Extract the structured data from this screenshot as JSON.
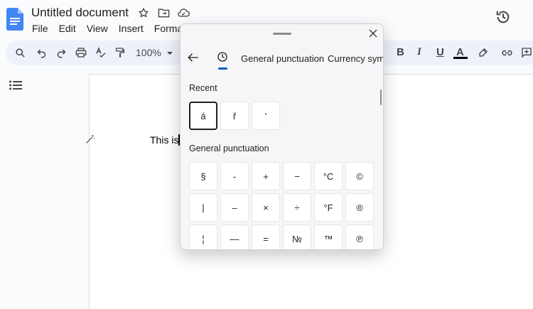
{
  "app": {
    "title": "Untitled document",
    "menu": [
      "File",
      "Edit",
      "View",
      "Insert",
      "Format"
    ]
  },
  "toolbar": {
    "zoom": "100%",
    "bold": "B",
    "italic": "I",
    "underline": "U",
    "text_color": "A"
  },
  "document": {
    "text": "This is"
  },
  "panel": {
    "tabs": [
      "General punctuation",
      "Currency symbo"
    ],
    "recent_label": "Recent",
    "recent": [
      "á",
      "ř",
      "ʹ"
    ],
    "section_label": "General punctuation",
    "symbols": [
      "§",
      "-",
      "+",
      "−",
      "°C",
      "©",
      "|",
      "–",
      "×",
      "÷",
      "°F",
      "®",
      "¦",
      "—",
      "=",
      "№",
      "™",
      "℗"
    ]
  },
  "colors": {
    "accent": "#005fb8",
    "docs_blue": "#4285f4",
    "toolbar_bg": "#edf2fa"
  }
}
